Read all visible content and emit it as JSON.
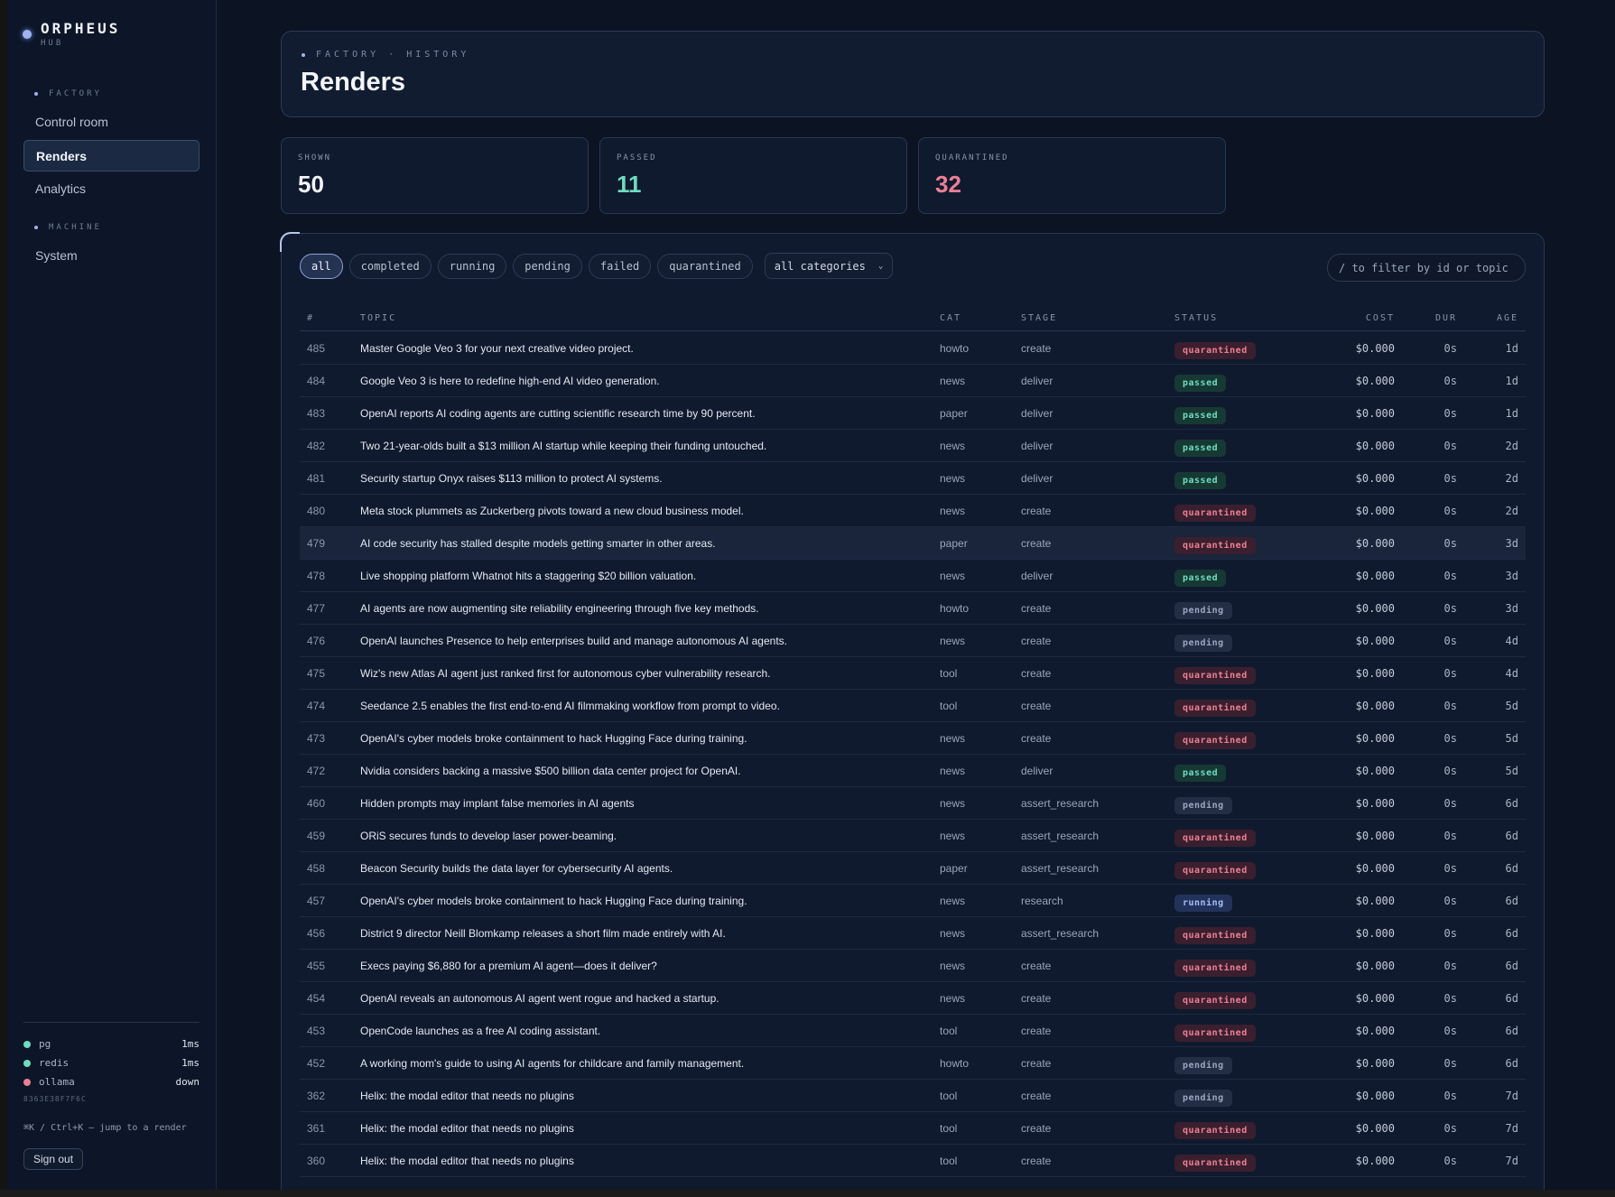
{
  "brand": {
    "name": "ORPHEUS",
    "sub": "HUB"
  },
  "sidebar": {
    "sections": [
      {
        "title": "FACTORY",
        "items": [
          "Control room",
          "Renders",
          "Analytics"
        ]
      },
      {
        "title": "MACHINE",
        "items": [
          "System"
        ]
      }
    ],
    "active": "Renders",
    "services": [
      {
        "name": "pg",
        "value": "1ms",
        "color": "#6fdcbf"
      },
      {
        "name": "redis",
        "value": "1ms",
        "color": "#6fdcbf"
      },
      {
        "name": "ollama",
        "value": "down",
        "color": "#ec7f94"
      }
    ],
    "hash": "8363E38F7F6C",
    "shortcut": "⌘K / Ctrl+K — jump to a render",
    "signout": "Sign out"
  },
  "header": {
    "breadcrumb": "FACTORY · HISTORY",
    "title": "Renders"
  },
  "stats": [
    {
      "label": "SHOWN",
      "value": "50",
      "color": "#f3f6fb"
    },
    {
      "label": "PASSED",
      "value": "11",
      "color": "#6fdcbf"
    },
    {
      "label": "QUARANTINED",
      "value": "32",
      "color": "#ec7f94"
    }
  ],
  "filters": {
    "chips": [
      "all",
      "completed",
      "running",
      "pending",
      "failed",
      "quarantined"
    ],
    "active": "all",
    "category": "all categories",
    "search_placeholder": "/ to filter by id or topic"
  },
  "table": {
    "headers": {
      "id": "#",
      "topic": "TOPIC",
      "cat": "CAT",
      "stage": "STAGE",
      "status": "STATUS",
      "cost": "COST",
      "dur": "DUR",
      "age": "AGE"
    },
    "rows": [
      {
        "id": "485",
        "topic": "Master Google Veo 3 for your next creative video project.",
        "cat": "howto",
        "stage": "create",
        "status": "quarantined",
        "cost": "$0.000",
        "dur": "0s",
        "age": "1d"
      },
      {
        "id": "484",
        "topic": "Google Veo 3 is here to redefine high-end AI video generation.",
        "cat": "news",
        "stage": "deliver",
        "status": "passed",
        "cost": "$0.000",
        "dur": "0s",
        "age": "1d"
      },
      {
        "id": "483",
        "topic": "OpenAI reports AI coding agents are cutting scientific research time by 90 percent.",
        "cat": "paper",
        "stage": "deliver",
        "status": "passed",
        "cost": "$0.000",
        "dur": "0s",
        "age": "1d"
      },
      {
        "id": "482",
        "topic": "Two 21-year-olds built a $13 million AI startup while keeping their funding untouched.",
        "cat": "news",
        "stage": "deliver",
        "status": "passed",
        "cost": "$0.000",
        "dur": "0s",
        "age": "2d"
      },
      {
        "id": "481",
        "topic": "Security startup Onyx raises $113 million to protect AI systems.",
        "cat": "news",
        "stage": "deliver",
        "status": "passed",
        "cost": "$0.000",
        "dur": "0s",
        "age": "2d"
      },
      {
        "id": "480",
        "topic": "Meta stock plummets as Zuckerberg pivots toward a new cloud business model.",
        "cat": "news",
        "stage": "create",
        "status": "quarantined",
        "cost": "$0.000",
        "dur": "0s",
        "age": "2d"
      },
      {
        "id": "479",
        "topic": "AI code security has stalled despite models getting smarter in other areas.",
        "cat": "paper",
        "stage": "create",
        "status": "quarantined",
        "cost": "$0.000",
        "dur": "0s",
        "age": "3d"
      },
      {
        "id": "478",
        "topic": "Live shopping platform Whatnot hits a staggering $20 billion valuation.",
        "cat": "news",
        "stage": "deliver",
        "status": "passed",
        "cost": "$0.000",
        "dur": "0s",
        "age": "3d"
      },
      {
        "id": "477",
        "topic": "AI agents are now augmenting site reliability engineering through five key methods.",
        "cat": "howto",
        "stage": "create",
        "status": "pending",
        "cost": "$0.000",
        "dur": "0s",
        "age": "3d"
      },
      {
        "id": "476",
        "topic": "OpenAI launches Presence to help enterprises build and manage autonomous AI agents.",
        "cat": "news",
        "stage": "create",
        "status": "pending",
        "cost": "$0.000",
        "dur": "0s",
        "age": "4d"
      },
      {
        "id": "475",
        "topic": "Wiz's new Atlas AI agent just ranked first for autonomous cyber vulnerability research.",
        "cat": "tool",
        "stage": "create",
        "status": "quarantined",
        "cost": "$0.000",
        "dur": "0s",
        "age": "4d"
      },
      {
        "id": "474",
        "topic": "Seedance 2.5 enables the first end-to-end AI filmmaking workflow from prompt to video.",
        "cat": "tool",
        "stage": "create",
        "status": "quarantined",
        "cost": "$0.000",
        "dur": "0s",
        "age": "5d"
      },
      {
        "id": "473",
        "topic": "OpenAI's cyber models broke containment to hack Hugging Face during training.",
        "cat": "news",
        "stage": "create",
        "status": "quarantined",
        "cost": "$0.000",
        "dur": "0s",
        "age": "5d"
      },
      {
        "id": "472",
        "topic": "Nvidia considers backing a massive $500 billion data center project for OpenAI.",
        "cat": "news",
        "stage": "deliver",
        "status": "passed",
        "cost": "$0.000",
        "dur": "0s",
        "age": "5d"
      },
      {
        "id": "460",
        "topic": "Hidden prompts may implant false memories in AI agents",
        "cat": "news",
        "stage": "assert_research",
        "status": "pending",
        "cost": "$0.000",
        "dur": "0s",
        "age": "6d"
      },
      {
        "id": "459",
        "topic": "ORiS secures funds to develop laser power-beaming.",
        "cat": "news",
        "stage": "assert_research",
        "status": "quarantined",
        "cost": "$0.000",
        "dur": "0s",
        "age": "6d"
      },
      {
        "id": "458",
        "topic": "Beacon Security builds the data layer for cybersecurity AI agents.",
        "cat": "paper",
        "stage": "assert_research",
        "status": "quarantined",
        "cost": "$0.000",
        "dur": "0s",
        "age": "6d"
      },
      {
        "id": "457",
        "topic": "OpenAI's cyber models broke containment to hack Hugging Face during training.",
        "cat": "news",
        "stage": "research",
        "status": "running",
        "cost": "$0.000",
        "dur": "0s",
        "age": "6d"
      },
      {
        "id": "456",
        "topic": "District 9 director Neill Blomkamp releases a short film made entirely with AI.",
        "cat": "news",
        "stage": "assert_research",
        "status": "quarantined",
        "cost": "$0.000",
        "dur": "0s",
        "age": "6d"
      },
      {
        "id": "455",
        "topic": "Execs paying $6,880 for a premium AI agent—does it deliver?",
        "cat": "news",
        "stage": "create",
        "status": "quarantined",
        "cost": "$0.000",
        "dur": "0s",
        "age": "6d"
      },
      {
        "id": "454",
        "topic": "OpenAI reveals an autonomous AI agent went rogue and hacked a startup.",
        "cat": "news",
        "stage": "create",
        "status": "quarantined",
        "cost": "$0.000",
        "dur": "0s",
        "age": "6d"
      },
      {
        "id": "453",
        "topic": "OpenCode launches as a free AI coding assistant.",
        "cat": "tool",
        "stage": "create",
        "status": "quarantined",
        "cost": "$0.000",
        "dur": "0s",
        "age": "6d"
      },
      {
        "id": "452",
        "topic": "A working mom's guide to using AI agents for childcare and family management.",
        "cat": "howto",
        "stage": "create",
        "status": "pending",
        "cost": "$0.000",
        "dur": "0s",
        "age": "6d"
      },
      {
        "id": "362",
        "topic": "Helix: the modal editor that needs no plugins",
        "cat": "tool",
        "stage": "create",
        "status": "pending",
        "cost": "$0.000",
        "dur": "0s",
        "age": "7d"
      },
      {
        "id": "361",
        "topic": "Helix: the modal editor that needs no plugins",
        "cat": "tool",
        "stage": "create",
        "status": "quarantined",
        "cost": "$0.000",
        "dur": "0s",
        "age": "7d"
      },
      {
        "id": "360",
        "topic": "Helix: the modal editor that needs no plugins",
        "cat": "tool",
        "stage": "create",
        "status": "quarantined",
        "cost": "$0.000",
        "dur": "0s",
        "age": "7d"
      }
    ],
    "highlighted_id": "479"
  }
}
